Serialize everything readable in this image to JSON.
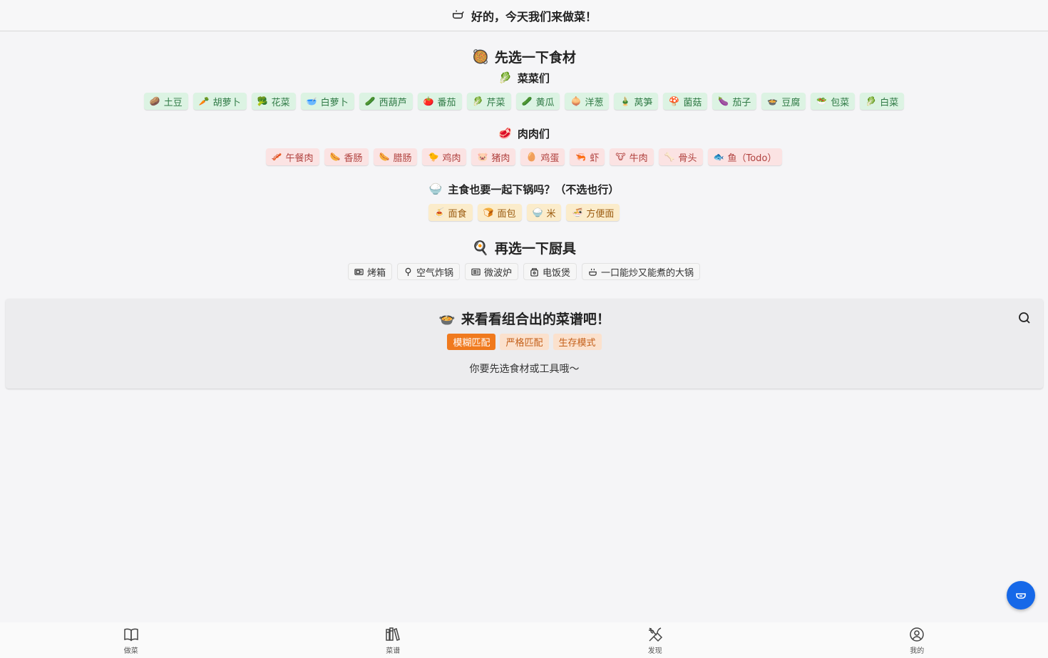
{
  "header": {
    "icon": "wok-icon",
    "title": "好的，今天我们来做菜！"
  },
  "ingredients": {
    "emoji": "🥘",
    "title": "先选一下食材",
    "vegetables": {
      "emoji": "🥬",
      "title": "菜菜们",
      "items": [
        {
          "emoji": "🥔",
          "label": "土豆"
        },
        {
          "emoji": "🥕",
          "label": "胡萝卜"
        },
        {
          "emoji": "🥦",
          "label": "花菜"
        },
        {
          "emoji": "🥣",
          "label": "白萝卜"
        },
        {
          "emoji": "🥒",
          "label": "西葫芦"
        },
        {
          "emoji": "🍅",
          "label": "番茄"
        },
        {
          "emoji": "🥬",
          "label": "芹菜"
        },
        {
          "emoji": "🥒",
          "label": "黄瓜"
        },
        {
          "emoji": "🧅",
          "label": "洋葱"
        },
        {
          "emoji": "🎍",
          "label": "莴笋"
        },
        {
          "emoji": "🍄",
          "label": "菌菇"
        },
        {
          "emoji": "🍆",
          "label": "茄子"
        },
        {
          "emoji": "🍲",
          "label": "豆腐"
        },
        {
          "emoji": "🥗",
          "label": "包菜"
        },
        {
          "emoji": "🥬",
          "label": "白菜"
        }
      ]
    },
    "meats": {
      "emoji": "🥩",
      "title": "肉肉们",
      "items": [
        {
          "emoji": "🥓",
          "label": "午餐肉"
        },
        {
          "emoji": "🌭",
          "label": "香肠"
        },
        {
          "emoji": "🌭",
          "label": "腊肠"
        },
        {
          "emoji": "🐤",
          "label": "鸡肉"
        },
        {
          "emoji": "🐷",
          "label": "猪肉"
        },
        {
          "emoji": "🥚",
          "label": "鸡蛋"
        },
        {
          "emoji": "🦐",
          "label": "虾"
        },
        {
          "emoji": "🐮",
          "label": "牛肉"
        },
        {
          "emoji": "🦴",
          "label": "骨头"
        },
        {
          "emoji": "🐟",
          "label": "鱼（Todo）"
        }
      ]
    },
    "staples": {
      "emoji": "🍚",
      "title": "主食也要一起下锅吗？（不选也行）",
      "items": [
        {
          "emoji": "🍝",
          "label": "面食"
        },
        {
          "emoji": "🍞",
          "label": "面包"
        },
        {
          "emoji": "🍚",
          "label": "米"
        },
        {
          "emoji": "🍜",
          "label": "方便面"
        }
      ]
    }
  },
  "tools": {
    "emoji": "🍳",
    "title": "再选一下厨具",
    "items": [
      {
        "icon": "oven-icon",
        "label": "烤箱"
      },
      {
        "icon": "air-fryer-icon",
        "label": "空气炸锅"
      },
      {
        "icon": "microwave-icon",
        "label": "微波炉"
      },
      {
        "icon": "rice-cooker-icon",
        "label": "电饭煲"
      },
      {
        "icon": "wok-icon",
        "label": "一口能炒又能煮的大锅"
      }
    ]
  },
  "result": {
    "emoji": "🍲",
    "title": "来看看组合出的菜谱吧！",
    "modes": [
      {
        "label": "模糊匹配",
        "active": true
      },
      {
        "label": "严格匹配",
        "active": false
      },
      {
        "label": "生存模式",
        "active": false
      }
    ],
    "hint": "你要先选食材或工具哦～",
    "search_icon": "search-icon"
  },
  "fab": {
    "icon": "bowl-icon"
  },
  "nav": [
    {
      "icon": "book-open-icon",
      "label": "做菜"
    },
    {
      "icon": "books-icon",
      "label": "菜谱"
    },
    {
      "icon": "utensils-icon",
      "label": "发现"
    },
    {
      "icon": "user-circle-icon",
      "label": "我的"
    }
  ],
  "colors": {
    "veg_bg": "#dcf3e3",
    "veg_text": "#2f7a45",
    "meat_bg": "#fbe3e3",
    "meat_text": "#b0413e",
    "staple_bg": "#fbeccb",
    "staple_text": "#9b5b10",
    "accent": "#f07a1e",
    "fab": "#1668e8"
  }
}
